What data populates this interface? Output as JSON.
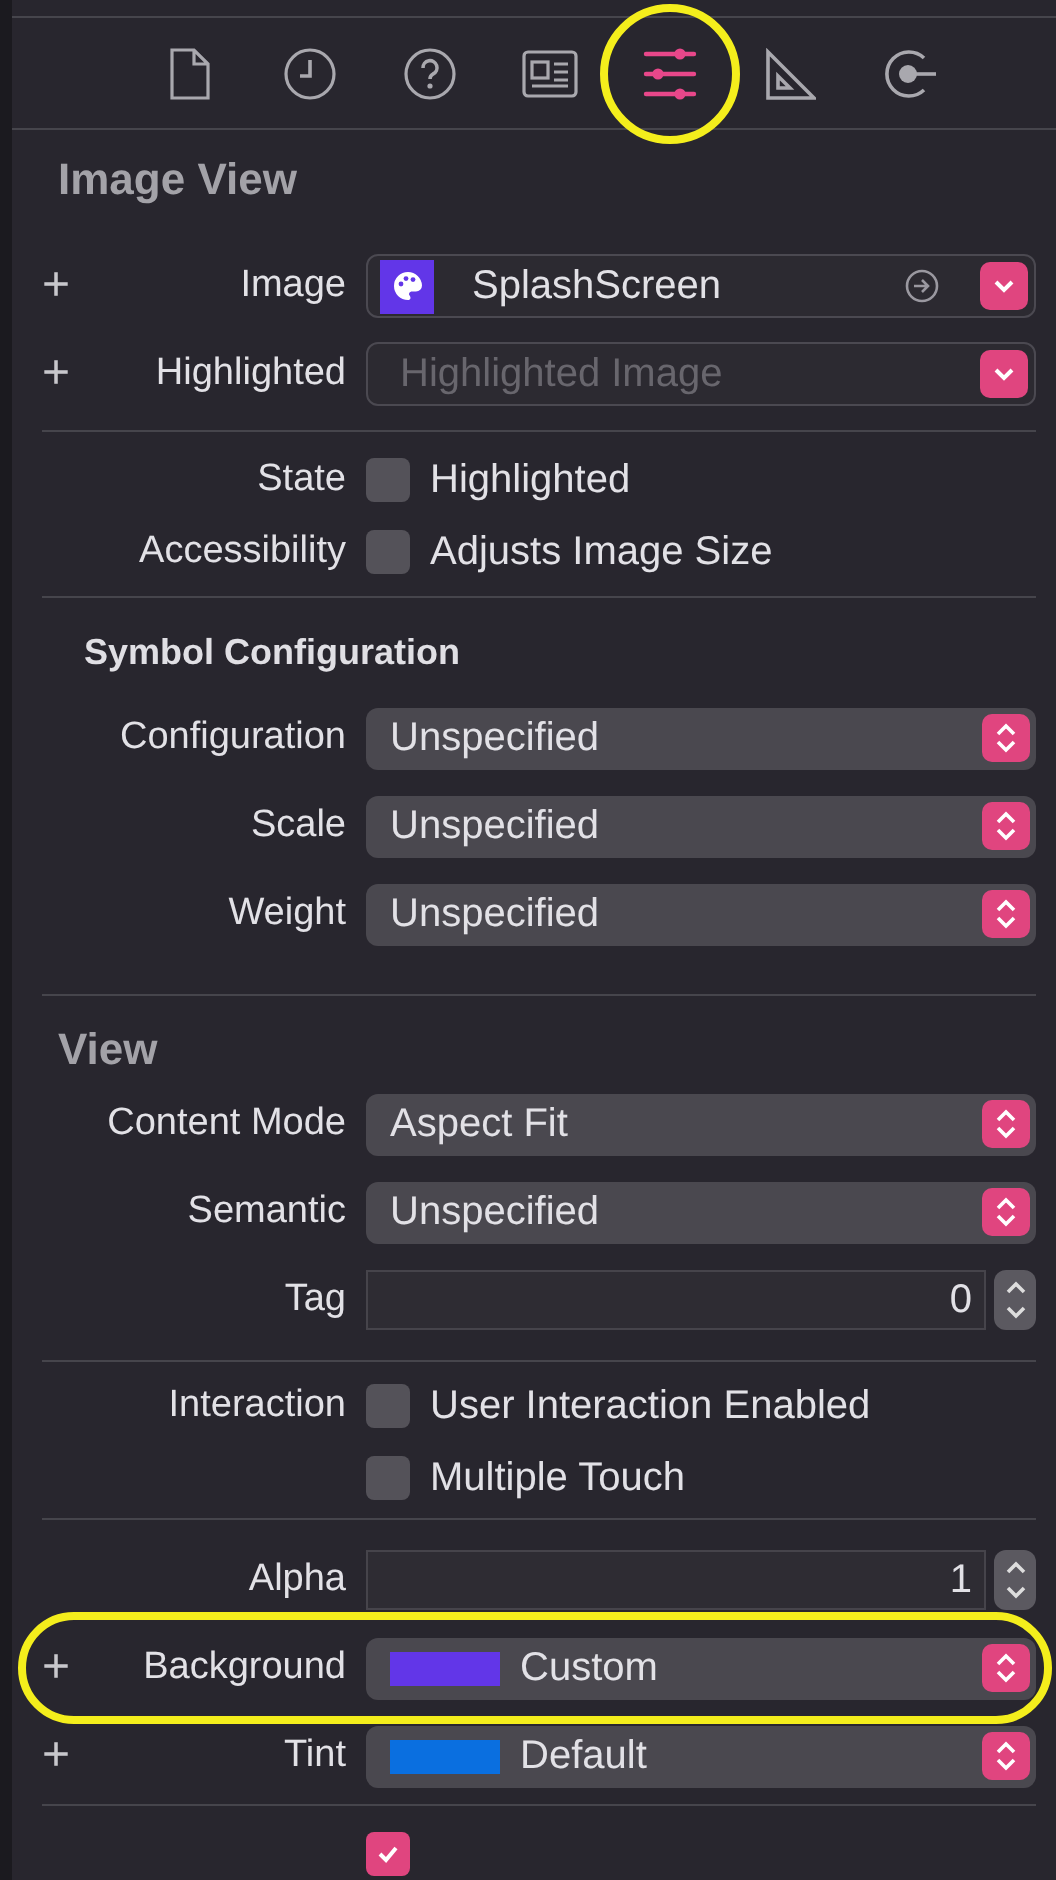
{
  "toolbar": {
    "tabs": [
      {
        "selected": false
      },
      {
        "selected": false
      },
      {
        "selected": false
      },
      {
        "selected": false
      },
      {
        "selected": true,
        "circled": true
      },
      {
        "selected": false
      },
      {
        "selected": false
      }
    ]
  },
  "groups": [
    {
      "title": {
        "text": "Image View",
        "kind": "section"
      },
      "rows": [
        {
          "kind": "image_popup",
          "plus": "+",
          "label": "Image",
          "value": "SplashScreen"
        },
        {
          "kind": "placeholder_popup",
          "plus": "+",
          "label": "Highlighted",
          "placeholder": "Highlighted Image"
        }
      ]
    },
    {
      "rows": [
        {
          "kind": "checkbox",
          "label": "State",
          "text": "Highlighted",
          "checked": false
        },
        {
          "kind": "checkbox",
          "label": "Accessibility",
          "text": "Adjusts Image Size",
          "checked": false
        }
      ]
    },
    {
      "title": {
        "text": "Symbol Configuration",
        "kind": "subsection"
      },
      "rows": [
        {
          "kind": "popup",
          "label": "Configuration",
          "value": "Unspecified"
        },
        {
          "kind": "popup",
          "label": "Scale",
          "value": "Unspecified"
        },
        {
          "kind": "popup",
          "label": "Weight",
          "value": "Unspecified"
        }
      ]
    },
    {
      "title": {
        "text": "View",
        "kind": "section"
      },
      "rows": [
        {
          "kind": "popup",
          "label": "Content Mode",
          "value": "Aspect Fit"
        },
        {
          "kind": "popup",
          "label": "Semantic",
          "value": "Unspecified"
        },
        {
          "kind": "stepper",
          "label": "Tag",
          "value": "0"
        }
      ]
    },
    {
      "rows": [
        {
          "kind": "checkbox",
          "label": "Interaction",
          "text": "User Interaction Enabled",
          "checked": false
        },
        {
          "kind": "checkbox",
          "text": "Multiple Touch",
          "checked": false
        }
      ]
    },
    {
      "rows": [
        {
          "kind": "stepper",
          "label": "Alpha",
          "value": "1"
        },
        {
          "kind": "color_popup",
          "plus": "+",
          "label": "Background",
          "value": "Custom",
          "color": "#6236e8",
          "circled": true
        },
        {
          "kind": "color_popup",
          "plus": "+",
          "label": "Tint",
          "value": "Default",
          "color": "#0a6fe0"
        }
      ]
    },
    {
      "rows": [
        {
          "kind": "checkbox",
          "checked": true
        }
      ]
    }
  ]
}
